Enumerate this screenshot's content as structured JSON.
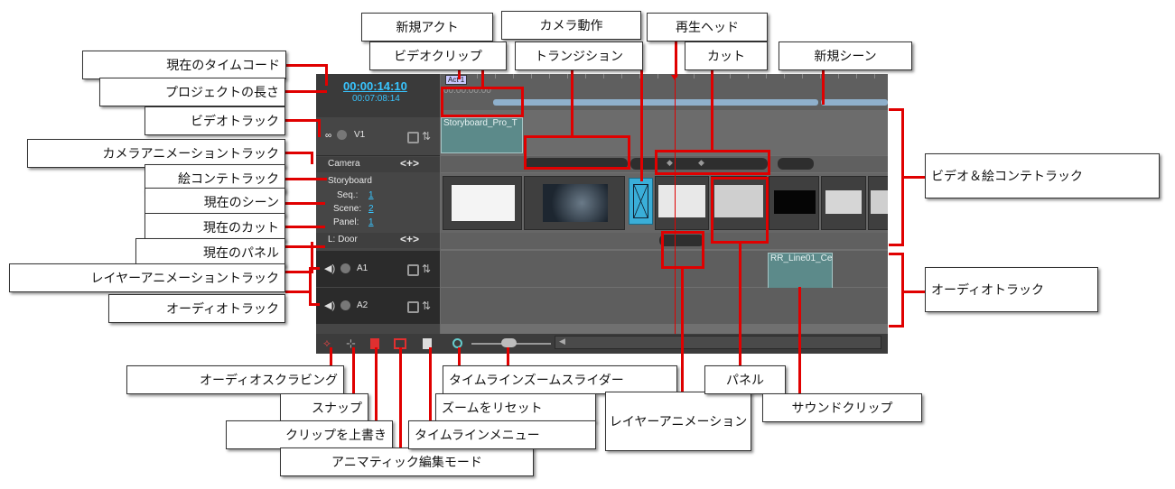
{
  "header": {
    "timecode": "00:00:14:10",
    "project_length": "00:07:08:14"
  },
  "tracks": {
    "v1": "V1",
    "camera": "Camera",
    "storyboard": "Storyboard",
    "seq_label": "Seq.:",
    "seq_value": "1",
    "scene_label": "Scene:",
    "scene_value": "2",
    "panel_label": "Panel:",
    "panel_value": "1",
    "layer": "L: Door",
    "a1": "A1",
    "a2": "A2",
    "nav": "<+>"
  },
  "timeline": {
    "act_label": "Act 1",
    "ruler_time": "00:00:00:00",
    "video_clip": "Storyboard_Pro_T",
    "sound_clip": "RR_Line01_Ce"
  },
  "callouts": {
    "new_act": "新規アクト",
    "camera_motion": "カメラ動作",
    "playhead": "再生ヘッド",
    "video_clip": "ビデオクリップ",
    "transition": "トランジション",
    "cut": "カット",
    "new_scene": "新規シーン",
    "current_timecode": "現在のタイムコード",
    "project_length": "プロジェクトの長さ",
    "video_track": "ビデオトラック",
    "camera_anim_track": "カメラアニメーショントラック",
    "storyboard_track": "絵コンテトラック",
    "current_scene": "現在のシーン",
    "current_cut": "現在のカット",
    "current_panel": "現在のパネル",
    "layer_anim_track": "レイヤーアニメーショントラック",
    "audio_track_left": "オーディオトラック",
    "video_storyboard_track": "ビデオ＆絵コンテトラック",
    "audio_track_right": "オーディオトラック",
    "audio_scrubbing": "オーディオスクラビング",
    "snap": "スナップ",
    "overwrite_clip": "クリップを上書き",
    "animatic_mode": "アニマティック編集モード",
    "zoom_slider": "タイムラインズームスライダー",
    "reset_zoom": "ズームをリセット",
    "timeline_menu": "タイムラインメニュー",
    "layer_animation": "レイヤーアニメーション",
    "panel": "パネル",
    "sound_clip": "サウンドクリップ"
  },
  "colors": {
    "accent": "#38c5ff",
    "callout_line": "#e00000",
    "transition": "#3aaed8"
  }
}
